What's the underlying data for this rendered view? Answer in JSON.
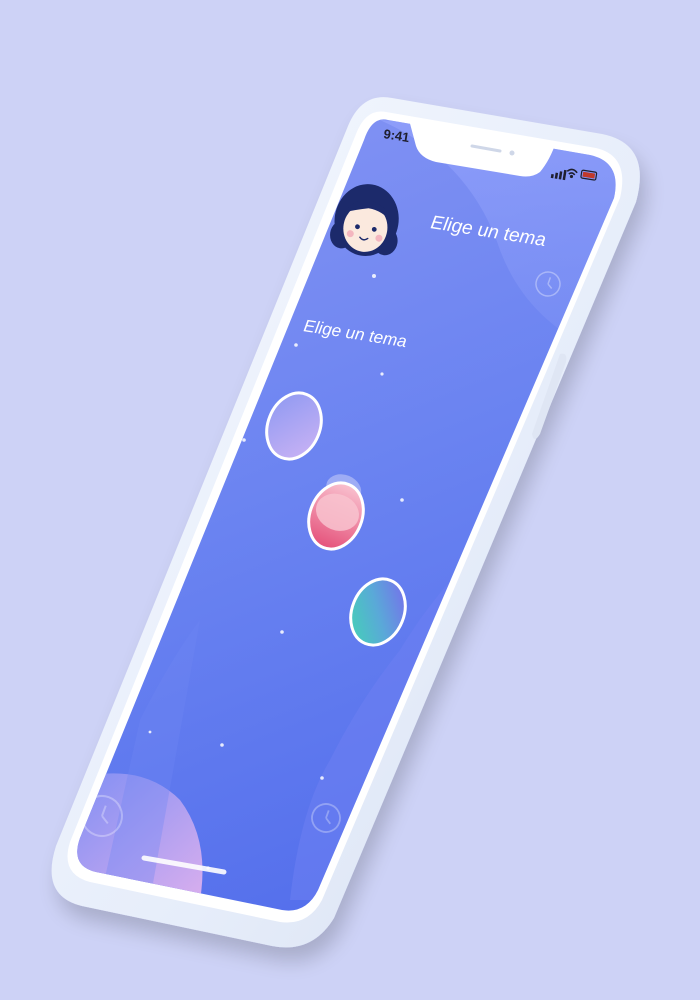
{
  "status_bar": {
    "time": "9:41"
  },
  "header": {
    "title": "Elige un tema"
  },
  "section": {
    "heading": "Elige un tema"
  },
  "themes": [
    {
      "name": "lavender",
      "colors": [
        "#9a9ff4",
        "#c8b4f2"
      ],
      "selected": false
    },
    {
      "name": "pink",
      "colors": [
        "#f7b3c4",
        "#e8527a"
      ],
      "selected": true
    },
    {
      "name": "mint",
      "colors": [
        "#3dd6b2",
        "#7d6ef2"
      ],
      "selected": false
    }
  ],
  "colors": {
    "background": "#cdd2f6",
    "phone_frame": "#eaf0fb",
    "screen_top": "#7f8ef3",
    "screen_bottom": "#5b78ee",
    "accent_pink": "#e8527a"
  },
  "icons": [
    "avatar-girl",
    "clock-icon",
    "signal-icon",
    "wifi-icon",
    "battery-icon"
  ]
}
